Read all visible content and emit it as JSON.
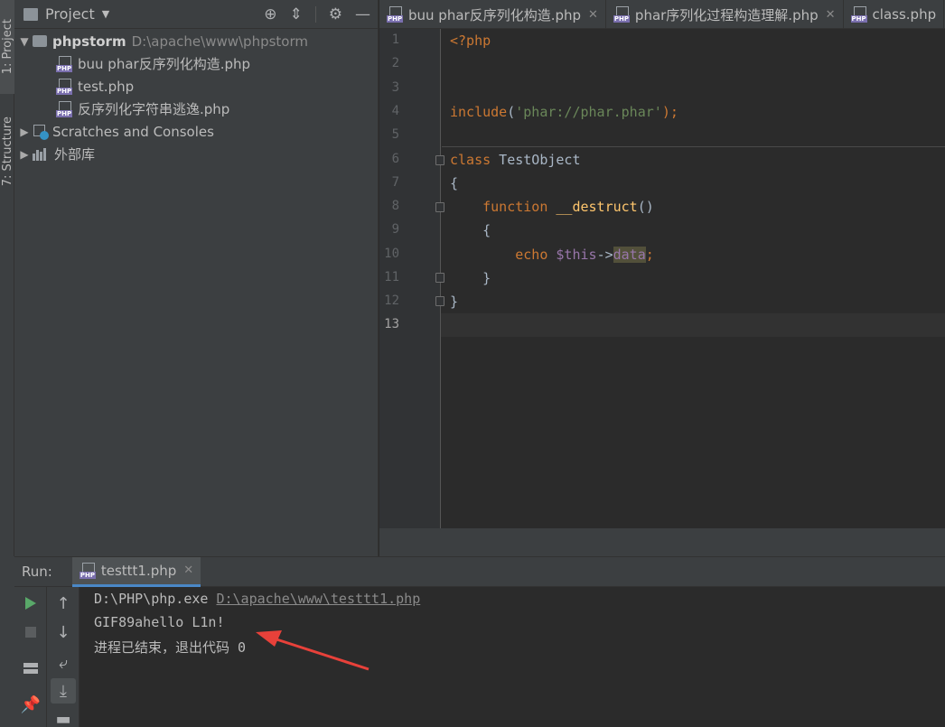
{
  "left_strip": {
    "project_tab": "1: Project",
    "structure_tab": "7: Structure"
  },
  "project_panel": {
    "title": "Project",
    "root": {
      "name": "phpstorm",
      "path": "D:\\apache\\www\\phpstorm"
    },
    "files": [
      "buu phar反序列化构造.php",
      "test.php",
      "反序列化字符串逃逸.php"
    ],
    "scratches": "Scratches and Consoles",
    "external_libs": "外部库"
  },
  "editor_tabs": [
    "buu phar反序列化构造.php",
    "phar序列化过程构造理解.php",
    "class.php"
  ],
  "editor": {
    "line_numbers": [
      "1",
      "2",
      "3",
      "4",
      "5",
      "6",
      "7",
      "8",
      "9",
      "10",
      "11",
      "12",
      "13"
    ],
    "current_line": "13",
    "code": {
      "l1": "<?php",
      "l4_fn": "include",
      "l4_open": "(",
      "l4_str": "'phar://phar.phar'",
      "l4_close": ");",
      "l6_kw": "class",
      "l6_name": " TestObject",
      "l7": "{",
      "l8_kw": "function",
      "l8_name": "__destruct",
      "l8_parens": "()",
      "l9": "{",
      "l10_kw": "echo",
      "l10_var": "$this",
      "l10_arrow": "->",
      "l10_prop": "data",
      "l10_semi": ";",
      "l11": "}",
      "l12": "}"
    }
  },
  "run_panel": {
    "label": "Run:",
    "tab": "testtt1.php",
    "console": {
      "exe": "D:\\PHP\\php.exe ",
      "script_link": "D:\\apache\\www\\testtt1.php",
      "output": "GIF89ahello L1n!",
      "exit_msg": "进程已结束，退出代码 0"
    }
  },
  "colors": {
    "keyword": "#cc7832",
    "string": "#6a8759",
    "function": "#ffc66d",
    "variable": "#9876aa",
    "arrow": "#e8413a",
    "run_icon": "#59a869"
  }
}
